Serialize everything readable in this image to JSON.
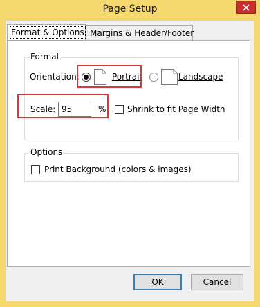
{
  "window": {
    "title": "Page Setup"
  },
  "tabs": [
    {
      "label": "Format & Options",
      "active": true
    },
    {
      "label": "Margins & Header/Footer",
      "active": false
    }
  ],
  "format": {
    "group_label": "Format",
    "orientation_label_pre": "Orientation:",
    "portrait_label": "Portrait",
    "landscape_label": "Landscape",
    "selected_orientation": "Portrait",
    "scale_label": "Scale:",
    "scale_value": "95",
    "scale_unit": "%",
    "shrink_label": "Shrink to fit Page Width",
    "shrink_checked": false
  },
  "options": {
    "group_label": "Options",
    "print_bg_label": "Print Background (colors & images)",
    "print_bg_checked": false
  },
  "buttons": {
    "ok": "OK",
    "cancel": "Cancel"
  },
  "colors": {
    "accent_highlight": "#d9383a",
    "titlebar": "#f5d96e",
    "close": "#c7302e"
  }
}
